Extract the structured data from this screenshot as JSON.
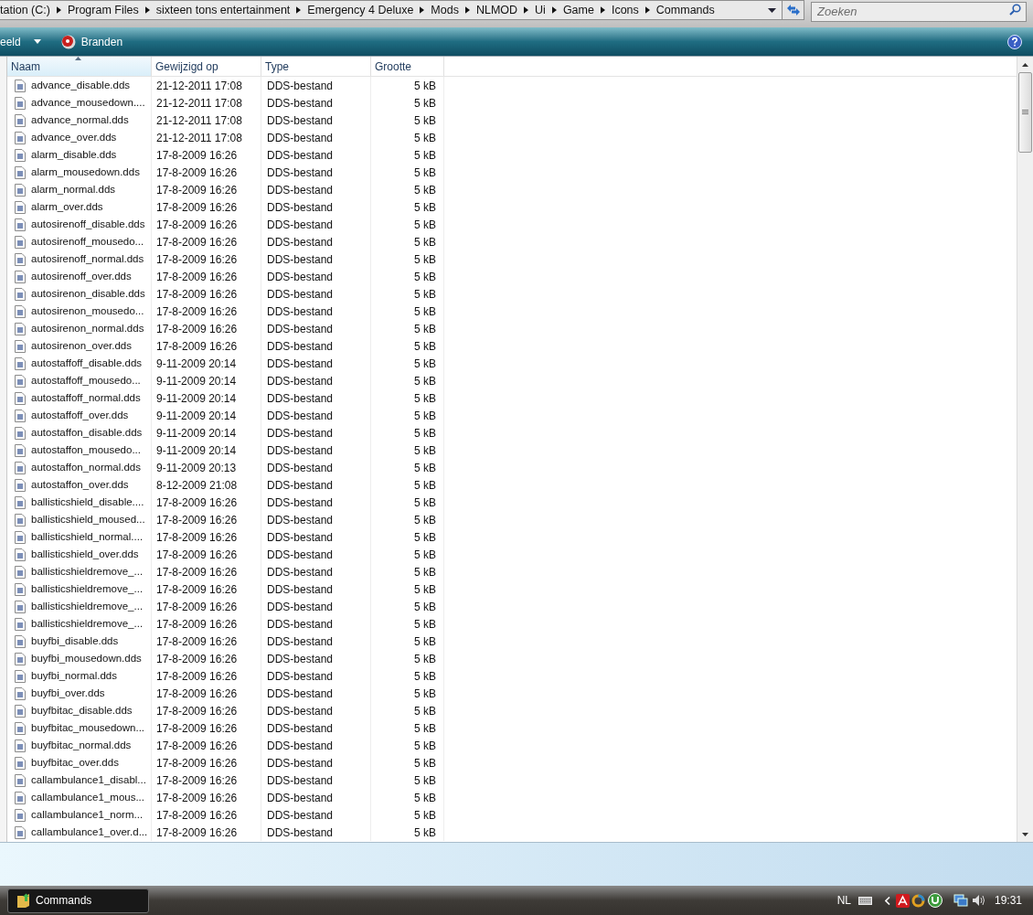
{
  "address_bar": {
    "segments": [
      "tation (C:)",
      "Program Files",
      "sixteen tons entertainment",
      "Emergency 4 Deluxe",
      "Mods",
      "NLMOD",
      "Ui",
      "Game",
      "Icons",
      "Commands"
    ]
  },
  "search": {
    "placeholder": "Zoeken"
  },
  "toolbar": {
    "items": [
      {
        "label": "eeld",
        "kind": "dropdown"
      },
      {
        "label": "Branden",
        "kind": "burn"
      }
    ]
  },
  "columns": [
    {
      "label": "Naam",
      "selected": true
    },
    {
      "label": "Gewijzigd op",
      "selected": false
    },
    {
      "label": "Type",
      "selected": false
    },
    {
      "label": "Grootte",
      "selected": false
    }
  ],
  "rows": [
    {
      "name": "advance_disable.dds",
      "modified": "21-12-2011 17:08",
      "type": "DDS-bestand",
      "size": "5 kB"
    },
    {
      "name": "advance_mousedown....",
      "modified": "21-12-2011 17:08",
      "type": "DDS-bestand",
      "size": "5 kB"
    },
    {
      "name": "advance_normal.dds",
      "modified": "21-12-2011 17:08",
      "type": "DDS-bestand",
      "size": "5 kB"
    },
    {
      "name": "advance_over.dds",
      "modified": "21-12-2011 17:08",
      "type": "DDS-bestand",
      "size": "5 kB"
    },
    {
      "name": "alarm_disable.dds",
      "modified": "17-8-2009 16:26",
      "type": "DDS-bestand",
      "size": "5 kB"
    },
    {
      "name": "alarm_mousedown.dds",
      "modified": "17-8-2009 16:26",
      "type": "DDS-bestand",
      "size": "5 kB"
    },
    {
      "name": "alarm_normal.dds",
      "modified": "17-8-2009 16:26",
      "type": "DDS-bestand",
      "size": "5 kB"
    },
    {
      "name": "alarm_over.dds",
      "modified": "17-8-2009 16:26",
      "type": "DDS-bestand",
      "size": "5 kB"
    },
    {
      "name": "autosirenoff_disable.dds",
      "modified": "17-8-2009 16:26",
      "type": "DDS-bestand",
      "size": "5 kB"
    },
    {
      "name": "autosirenoff_mousedo...",
      "modified": "17-8-2009 16:26",
      "type": "DDS-bestand",
      "size": "5 kB"
    },
    {
      "name": "autosirenoff_normal.dds",
      "modified": "17-8-2009 16:26",
      "type": "DDS-bestand",
      "size": "5 kB"
    },
    {
      "name": "autosirenoff_over.dds",
      "modified": "17-8-2009 16:26",
      "type": "DDS-bestand",
      "size": "5 kB"
    },
    {
      "name": "autosirenon_disable.dds",
      "modified": "17-8-2009 16:26",
      "type": "DDS-bestand",
      "size": "5 kB"
    },
    {
      "name": "autosirenon_mousedo...",
      "modified": "17-8-2009 16:26",
      "type": "DDS-bestand",
      "size": "5 kB"
    },
    {
      "name": "autosirenon_normal.dds",
      "modified": "17-8-2009 16:26",
      "type": "DDS-bestand",
      "size": "5 kB"
    },
    {
      "name": "autosirenon_over.dds",
      "modified": "17-8-2009 16:26",
      "type": "DDS-bestand",
      "size": "5 kB"
    },
    {
      "name": "autostaffoff_disable.dds",
      "modified": "9-11-2009 20:14",
      "type": "DDS-bestand",
      "size": "5 kB"
    },
    {
      "name": "autostaffoff_mousedo...",
      "modified": "9-11-2009 20:14",
      "type": "DDS-bestand",
      "size": "5 kB"
    },
    {
      "name": "autostaffoff_normal.dds",
      "modified": "9-11-2009 20:14",
      "type": "DDS-bestand",
      "size": "5 kB"
    },
    {
      "name": "autostaffoff_over.dds",
      "modified": "9-11-2009 20:14",
      "type": "DDS-bestand",
      "size": "5 kB"
    },
    {
      "name": "autostaffon_disable.dds",
      "modified": "9-11-2009 20:14",
      "type": "DDS-bestand",
      "size": "5 kB"
    },
    {
      "name": "autostaffon_mousedo...",
      "modified": "9-11-2009 20:14",
      "type": "DDS-bestand",
      "size": "5 kB"
    },
    {
      "name": "autostaffon_normal.dds",
      "modified": "9-11-2009 20:13",
      "type": "DDS-bestand",
      "size": "5 kB"
    },
    {
      "name": "autostaffon_over.dds",
      "modified": "8-12-2009 21:08",
      "type": "DDS-bestand",
      "size": "5 kB"
    },
    {
      "name": "ballisticshield_disable....",
      "modified": "17-8-2009 16:26",
      "type": "DDS-bestand",
      "size": "5 kB"
    },
    {
      "name": "ballisticshield_moused...",
      "modified": "17-8-2009 16:26",
      "type": "DDS-bestand",
      "size": "5 kB"
    },
    {
      "name": "ballisticshield_normal....",
      "modified": "17-8-2009 16:26",
      "type": "DDS-bestand",
      "size": "5 kB"
    },
    {
      "name": "ballisticshield_over.dds",
      "modified": "17-8-2009 16:26",
      "type": "DDS-bestand",
      "size": "5 kB"
    },
    {
      "name": "ballisticshieldremove_...",
      "modified": "17-8-2009 16:26",
      "type": "DDS-bestand",
      "size": "5 kB"
    },
    {
      "name": "ballisticshieldremove_...",
      "modified": "17-8-2009 16:26",
      "type": "DDS-bestand",
      "size": "5 kB"
    },
    {
      "name": "ballisticshieldremove_...",
      "modified": "17-8-2009 16:26",
      "type": "DDS-bestand",
      "size": "5 kB"
    },
    {
      "name": "ballisticshieldremove_...",
      "modified": "17-8-2009 16:26",
      "type": "DDS-bestand",
      "size": "5 kB"
    },
    {
      "name": "buyfbi_disable.dds",
      "modified": "17-8-2009 16:26",
      "type": "DDS-bestand",
      "size": "5 kB"
    },
    {
      "name": "buyfbi_mousedown.dds",
      "modified": "17-8-2009 16:26",
      "type": "DDS-bestand",
      "size": "5 kB"
    },
    {
      "name": "buyfbi_normal.dds",
      "modified": "17-8-2009 16:26",
      "type": "DDS-bestand",
      "size": "5 kB"
    },
    {
      "name": "buyfbi_over.dds",
      "modified": "17-8-2009 16:26",
      "type": "DDS-bestand",
      "size": "5 kB"
    },
    {
      "name": "buyfbitac_disable.dds",
      "modified": "17-8-2009 16:26",
      "type": "DDS-bestand",
      "size": "5 kB"
    },
    {
      "name": "buyfbitac_mousedown...",
      "modified": "17-8-2009 16:26",
      "type": "DDS-bestand",
      "size": "5 kB"
    },
    {
      "name": "buyfbitac_normal.dds",
      "modified": "17-8-2009 16:26",
      "type": "DDS-bestand",
      "size": "5 kB"
    },
    {
      "name": "buyfbitac_over.dds",
      "modified": "17-8-2009 16:26",
      "type": "DDS-bestand",
      "size": "5 kB"
    },
    {
      "name": "callambulance1_disabl...",
      "modified": "17-8-2009 16:26",
      "type": "DDS-bestand",
      "size": "5 kB"
    },
    {
      "name": "callambulance1_mous...",
      "modified": "17-8-2009 16:26",
      "type": "DDS-bestand",
      "size": "5 kB"
    },
    {
      "name": "callambulance1_norm...",
      "modified": "17-8-2009 16:26",
      "type": "DDS-bestand",
      "size": "5 kB"
    },
    {
      "name": "callambulance1_over.d...",
      "modified": "17-8-2009 16:26",
      "type": "DDS-bestand",
      "size": "5 kB"
    }
  ],
  "taskbar": {
    "button": "Commands",
    "language": "NL",
    "clock": "19:31"
  }
}
